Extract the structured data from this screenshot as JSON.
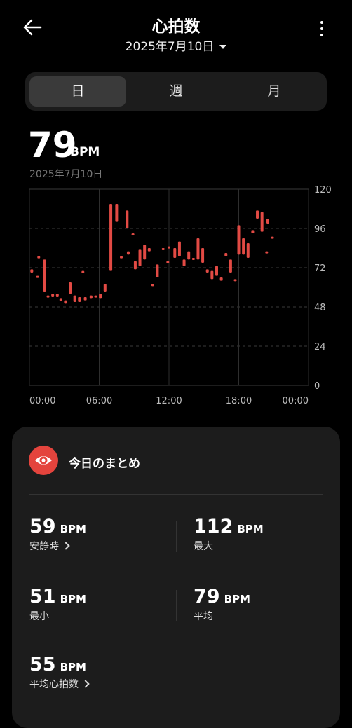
{
  "header": {
    "title": "心拍数",
    "date": "2025年7月10日"
  },
  "tabs": [
    {
      "label": "日",
      "active": true
    },
    {
      "label": "週",
      "active": false
    },
    {
      "label": "月",
      "active": false
    }
  ],
  "current": {
    "value": "79",
    "unit": "BPM",
    "date": "2025年7月10日"
  },
  "chart_data": {
    "type": "bar",
    "y_ticks": [
      "120",
      "96",
      "72",
      "48",
      "24",
      "0"
    ],
    "x_ticks": [
      "00:00",
      "06:00",
      "12:00",
      "18:00",
      "00:00"
    ],
    "ylim": [
      0,
      120
    ],
    "x_range_hours": [
      0,
      24
    ],
    "color": "#e24a44",
    "grid": true,
    "ranges": [
      {
        "t": 0.2,
        "lo": 69,
        "hi": 71
      },
      {
        "t": 0.7,
        "lo": 66,
        "hi": 67
      },
      {
        "t": 0.8,
        "lo": 78,
        "hi": 79
      },
      {
        "t": 1.3,
        "lo": 57,
        "hi": 77
      },
      {
        "t": 1.6,
        "lo": 54,
        "hi": 55
      },
      {
        "t": 2.0,
        "lo": 54,
        "hi": 56
      },
      {
        "t": 2.4,
        "lo": 54,
        "hi": 56
      },
      {
        "t": 2.7,
        "lo": 52,
        "hi": 53
      },
      {
        "t": 3.1,
        "lo": 50,
        "hi": 52
      },
      {
        "t": 3.5,
        "lo": 56,
        "hi": 63
      },
      {
        "t": 3.9,
        "lo": 51,
        "hi": 55
      },
      {
        "t": 4.3,
        "lo": 51,
        "hi": 54
      },
      {
        "t": 4.6,
        "lo": 69,
        "hi": 70
      },
      {
        "t": 4.8,
        "lo": 52,
        "hi": 54
      },
      {
        "t": 5.3,
        "lo": 53,
        "hi": 55
      },
      {
        "t": 5.7,
        "lo": 54,
        "hi": 55
      },
      {
        "t": 6.1,
        "lo": 53,
        "hi": 56
      },
      {
        "t": 6.5,
        "lo": 57,
        "hi": 62
      },
      {
        "t": 7.0,
        "lo": 70,
        "hi": 111
      },
      {
        "t": 7.5,
        "lo": 100,
        "hi": 111
      },
      {
        "t": 7.9,
        "lo": 78,
        "hi": 79
      },
      {
        "t": 8.4,
        "lo": 96,
        "hi": 107
      },
      {
        "t": 8.5,
        "lo": 80,
        "hi": 82
      },
      {
        "t": 8.9,
        "lo": 92,
        "hi": 93
      },
      {
        "t": 9.1,
        "lo": 71,
        "hi": 76
      },
      {
        "t": 9.5,
        "lo": 73,
        "hi": 83
      },
      {
        "t": 9.9,
        "lo": 77,
        "hi": 86
      },
      {
        "t": 10.3,
        "lo": 82,
        "hi": 84
      },
      {
        "t": 10.6,
        "lo": 61,
        "hi": 62
      },
      {
        "t": 11.0,
        "lo": 66,
        "hi": 74
      },
      {
        "t": 11.5,
        "lo": 83,
        "hi": 84
      },
      {
        "t": 11.9,
        "lo": 75,
        "hi": 76
      },
      {
        "t": 12.0,
        "lo": 84,
        "hi": 85
      },
      {
        "t": 12.5,
        "lo": 78,
        "hi": 84
      },
      {
        "t": 12.9,
        "lo": 79,
        "hi": 88
      },
      {
        "t": 13.3,
        "lo": 73,
        "hi": 77
      },
      {
        "t": 13.7,
        "lo": 77,
        "hi": 82
      },
      {
        "t": 14.1,
        "lo": 77,
        "hi": 78
      },
      {
        "t": 14.5,
        "lo": 77,
        "hi": 90
      },
      {
        "t": 14.9,
        "lo": 75,
        "hi": 84
      },
      {
        "t": 15.3,
        "lo": 69,
        "hi": 71
      },
      {
        "t": 15.7,
        "lo": 65,
        "hi": 70
      },
      {
        "t": 16.1,
        "lo": 67,
        "hi": 73
      },
      {
        "t": 16.5,
        "lo": 64,
        "hi": 66
      },
      {
        "t": 16.9,
        "lo": 79,
        "hi": 81
      },
      {
        "t": 17.3,
        "lo": 69,
        "hi": 77
      },
      {
        "t": 17.7,
        "lo": 64,
        "hi": 65
      },
      {
        "t": 18.0,
        "lo": 80,
        "hi": 98
      },
      {
        "t": 18.4,
        "lo": 80,
        "hi": 90
      },
      {
        "t": 18.8,
        "lo": 78,
        "hi": 87
      },
      {
        "t": 19.2,
        "lo": 93,
        "hi": 95
      },
      {
        "t": 19.6,
        "lo": 102,
        "hi": 107
      },
      {
        "t": 20.0,
        "lo": 94,
        "hi": 106
      },
      {
        "t": 20.4,
        "lo": 81,
        "hi": 82
      },
      {
        "t": 20.5,
        "lo": 99,
        "hi": 102
      },
      {
        "t": 20.9,
        "lo": 90,
        "hi": 91
      }
    ]
  },
  "summary": {
    "title": "今日のまとめ",
    "stats": [
      {
        "value": "59",
        "unit": "BPM",
        "label": "安静時",
        "link": true
      },
      {
        "value": "112",
        "unit": "BPM",
        "label": "最大",
        "link": false
      },
      {
        "value": "51",
        "unit": "BPM",
        "label": "最小",
        "link": false
      },
      {
        "value": "79",
        "unit": "BPM",
        "label": "平均",
        "link": false
      },
      {
        "value": "55",
        "unit": "BPM",
        "label": "平均心拍数",
        "link": true
      }
    ]
  }
}
